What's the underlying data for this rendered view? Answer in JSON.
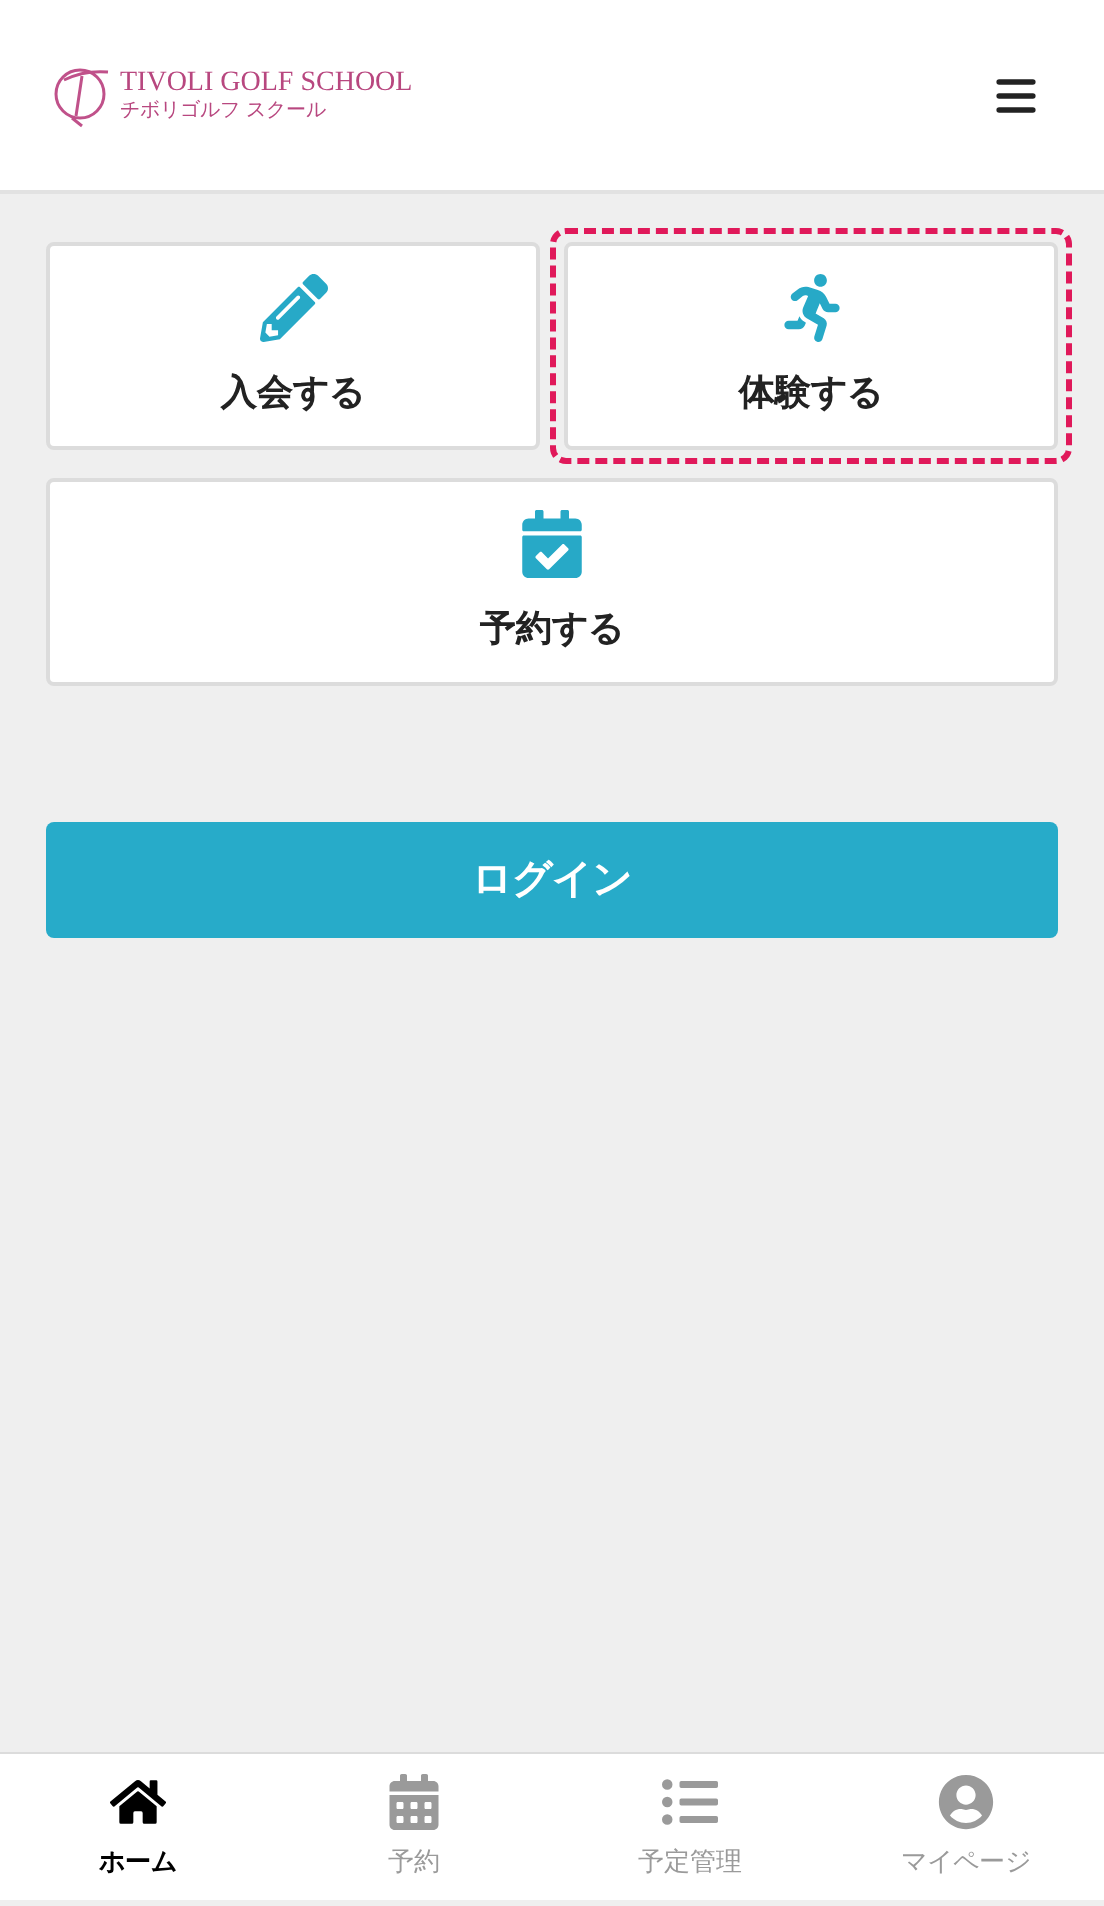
{
  "header": {
    "logo_title": "TIVOLI GOLF SCHOOL",
    "logo_subtitle": "チボリゴルフ スクール"
  },
  "cards": [
    {
      "kind": "pencil",
      "label": "入会する",
      "highlighted": false,
      "wide": false
    },
    {
      "kind": "runner",
      "label": "体験する",
      "highlighted": true,
      "wide": false
    },
    {
      "kind": "calendar-check",
      "label": "予約する",
      "highlighted": false,
      "wide": true
    }
  ],
  "login_button": "ログイン",
  "bottom_nav": [
    {
      "kind": "home",
      "label": "ホーム",
      "selected": true
    },
    {
      "kind": "calendar",
      "label": "予約",
      "selected": false
    },
    {
      "kind": "list",
      "label": "予定管理",
      "selected": false
    },
    {
      "kind": "user",
      "label": "マイページ",
      "selected": false
    }
  ]
}
